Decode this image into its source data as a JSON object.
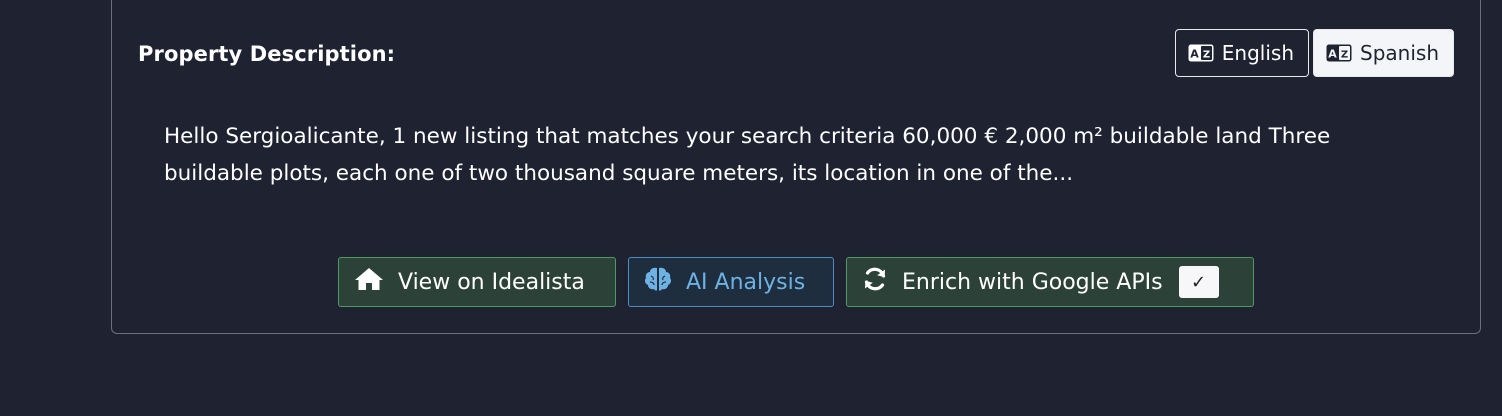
{
  "panel": {
    "title": "Property Description:",
    "languages": {
      "english": {
        "label": "English",
        "icon": "translate-icon"
      },
      "spanish": {
        "label": "Spanish",
        "icon": "translate-icon",
        "selected": true
      }
    },
    "description": "Hello Sergioalicante, 1 new listing that matches your search criteria 60,000 € 2,000 m² buildable land Three buildable plots, each one of two thousand square meters, its location in one of the..."
  },
  "actions": {
    "view_idealista": {
      "label": "View on Idealista",
      "icon": "home-icon"
    },
    "ai_analysis": {
      "label": "AI Analysis",
      "icon": "brain-icon"
    },
    "enrich": {
      "label": "Enrich with Google APIs",
      "icon": "refresh-icon",
      "check": "✓"
    }
  },
  "colors": {
    "background": "#1e2231",
    "green_accent": "#4f9a63",
    "blue_accent": "#4a8fc4",
    "blue_text": "#6eb2e4"
  }
}
